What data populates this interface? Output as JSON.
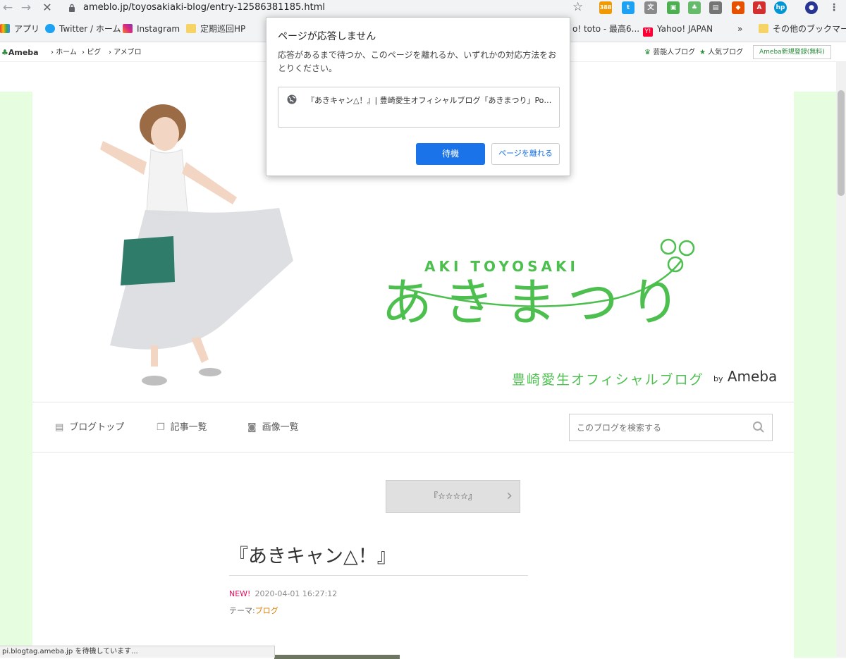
{
  "browser": {
    "url": "ameblo.jp/toyosakiaki-blog/entry-12586381185.html",
    "back_icon": "arrow-left-icon",
    "forward_icon": "arrow-right-icon",
    "stop_icon": "close-icon",
    "extension_badge": "388",
    "bookmarks": [
      {
        "label": "アプリ"
      },
      {
        "label": "Twitter / ホーム"
      },
      {
        "label": "Instagram"
      },
      {
        "label": "定期巡回HP"
      },
      {
        "label": "o! toto - 最高6..."
      },
      {
        "label": "Yahoo! JAPAN"
      },
      {
        "label": "»"
      },
      {
        "label": "その他のブックマーク"
      }
    ],
    "status_text": "pi.blogtag.ameba.jp を待機しています..."
  },
  "ameba_bar": {
    "logo": "Ameba",
    "links": [
      "ホーム",
      "ピグ",
      "アメブロ"
    ],
    "right_links": [
      "芸能人ブログ",
      "人気ブログ"
    ],
    "register": "Ameba新規登録(無料)"
  },
  "header": {
    "aki_line": "AKI TOYOSAKI",
    "title": "あきまつり",
    "subtitle": "豊崎愛生オフィシャルブログ",
    "by": "by",
    "ameba": "Ameba"
  },
  "nav": {
    "items": [
      "ブログトップ",
      "記事一覧",
      "画像一覧"
    ],
    "search_placeholder": "このブログを検索する"
  },
  "entry": {
    "prev_title": "『☆☆☆☆』",
    "title": "『あきキャン△！』",
    "new_label": "NEW!",
    "datetime": "2020-04-01 16:27:12",
    "theme_label": "テーマ:",
    "theme": "ブログ"
  },
  "dialog": {
    "title": "ページが応答しません",
    "body": "応答があるまで待つか、このページを離れるか、いずれかの対応方法をおとりください。",
    "page_title": "『あきキャン△！』| 豊崎愛生オフィシャルブログ「あきまつり」Powered by Ame...",
    "wait": "待機",
    "leave": "ページを離れる"
  },
  "colors": {
    "accent_green": "#4cbf4f",
    "side_bg": "#e6fde0",
    "primary_blue": "#1a73e8",
    "new_pink": "#e0115f",
    "theme_orange": "#e07b00"
  }
}
